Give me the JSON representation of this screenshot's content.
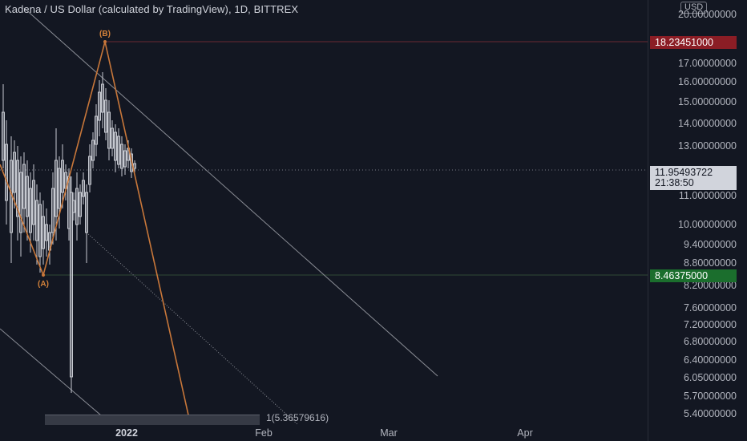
{
  "header": {
    "title": "Kadena / US Dollar (calculated by TradingView), 1D, BITTREX"
  },
  "price_axis": {
    "currency": "USD",
    "ticks": [
      "20.00000000",
      "17.00000000",
      "16.00000000",
      "15.00000000",
      "14.00000000",
      "13.00000000",
      "11.00000000",
      "10.00000000",
      "9.40000000",
      "8.80000000",
      "8.20000000",
      "7.60000000",
      "7.20000000",
      "6.80000000",
      "6.40000000",
      "6.05000000",
      "5.70000000",
      "5.40000000"
    ],
    "high_label": "18.23451000",
    "low_label": "8.46375000",
    "current_price": "11.95493722",
    "countdown": "21:38:50"
  },
  "time_axis": {
    "ticks": [
      "2022",
      "Feb",
      "Mar",
      "Apr"
    ]
  },
  "annotations": {
    "wave_a": "(A)",
    "wave_b": "(B)",
    "fib_level": "1(5.36579616)"
  },
  "colors": {
    "background": "#131722",
    "candle": "#c7cad1",
    "wave_line": "#c8773a",
    "trendline": "#8a8d95",
    "high_label": "#8b1d25",
    "low_label": "#1b6e2d"
  }
}
